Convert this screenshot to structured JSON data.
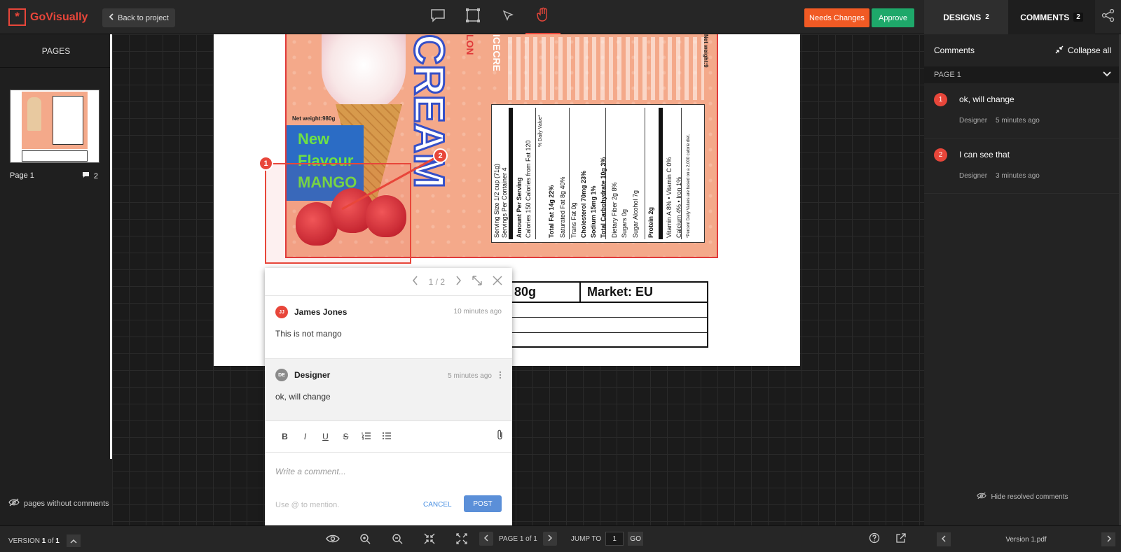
{
  "app": {
    "brand": "GoVisually",
    "logo_glyph": "*"
  },
  "topbar": {
    "back_label": "Back to project",
    "needs_changes_label": "Needs Changes",
    "approve_label": "Approve",
    "tabs": [
      {
        "label": "DESIGNS",
        "count": "2"
      },
      {
        "label": "COMMENTS",
        "count": "2"
      }
    ],
    "tools": [
      "comment-tool-icon",
      "rectangle-tool-icon",
      "pen-tool-icon",
      "hand-tool-icon"
    ],
    "active_tool": "hand-tool-icon"
  },
  "sidebar": {
    "title": "PAGES",
    "pages": [
      {
        "label": "Page 1",
        "comment_count": "2"
      }
    ],
    "pages_without_comments": "pages without comments"
  },
  "artwork": {
    "net_weight": "Net weight:980g",
    "flavour_lines": [
      "New",
      "Flavour",
      "MANGO"
    ],
    "big_title": "CREAM",
    "side_red": "LON",
    "side_pink": "ICECRE",
    "side_netweight": "Net weight:9",
    "nutrition": [
      "Serving Size 1/2 cup (71g)",
      "Servings Per Container 4",
      "Amount Per Serving",
      "Calories 150   Calories from Fat 120",
      "% Daily Value*",
      "Total Fat 14g  22%",
      "Saturated Fat 8g  40%",
      "Trans Fat 0g",
      "Cholesterol 70mg  23%",
      "Sodium 15mg  1%",
      "Total Carbohydrate 10g  3%",
      "Dietary Fiber 2g  8%",
      "Sugars 0g",
      "Sugar Alcohol 7g",
      "Protein 2g",
      "Vitamin A 8%  •  Vitamin C 0%",
      "Calcium 4%  •  Iron 1%",
      "*Percent Daily Values are based on a 2,000 calorie diet."
    ],
    "market_cells": [
      "80g",
      "Market: EU"
    ]
  },
  "markers": [
    "1",
    "2"
  ],
  "popup": {
    "pager": "1 / 2",
    "messages": [
      {
        "initials": "JJ",
        "author": "James Jones",
        "time": "10 minutes ago",
        "text": "This is not mango"
      },
      {
        "initials": "DE",
        "author": "Designer",
        "time": "5 minutes ago",
        "text": "ok, will change"
      }
    ],
    "format_buttons": [
      "B",
      "I",
      "U",
      "S"
    ],
    "placeholder": "Write a comment...",
    "mention_hint": "Use @ to mention.",
    "cancel_label": "CANCEL",
    "post_label": "POST"
  },
  "comments_panel": {
    "title": "Comments",
    "collapse_label": "Collapse all",
    "group_label": "PAGE 1",
    "items": [
      {
        "num": "1",
        "text": "ok, will change",
        "author": "Designer",
        "time": "5 minutes ago"
      },
      {
        "num": "2",
        "text": "I can see that",
        "author": "Designer",
        "time": "3 minutes ago"
      }
    ],
    "hide_resolved": "Hide resolved comments"
  },
  "bottombar": {
    "version_label": "VERSION",
    "version_current": "1",
    "version_of": "of",
    "version_total": "1",
    "page_label": "PAGE 1 of 1",
    "jump_label": "JUMP TO",
    "jump_value": "1",
    "go_label": "GO",
    "file_name": "Version 1.pdf"
  },
  "colors": {
    "accent": "#e8463a",
    "needs_changes": "#f15a24",
    "approve": "#1ea86a",
    "post": "#5b8fd8"
  }
}
